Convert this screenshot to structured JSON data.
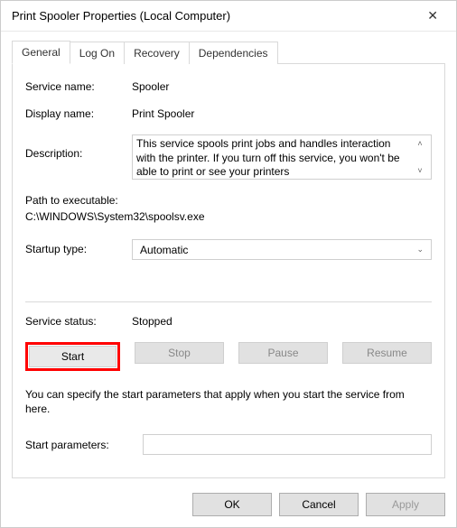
{
  "window": {
    "title": "Print Spooler Properties (Local Computer)"
  },
  "tabs": {
    "general": "General",
    "logon": "Log On",
    "recovery": "Recovery",
    "dependencies": "Dependencies"
  },
  "labels": {
    "service_name": "Service name:",
    "display_name": "Display name:",
    "description": "Description:",
    "path": "Path to executable:",
    "startup_type": "Startup type:",
    "service_status": "Service status:",
    "start_parameters": "Start parameters:"
  },
  "values": {
    "service_name": "Spooler",
    "display_name": "Print Spooler",
    "description": "This service spools print jobs and handles interaction with the printer.  If you turn off this service, you won't be able to print or see your printers",
    "path": "C:\\WINDOWS\\System32\\spoolsv.exe",
    "startup_type": "Automatic",
    "service_status": "Stopped",
    "start_parameters": ""
  },
  "buttons": {
    "start": "Start",
    "stop": "Stop",
    "pause": "Pause",
    "resume": "Resume",
    "ok": "OK",
    "cancel": "Cancel",
    "apply": "Apply"
  },
  "notes": {
    "params": "You can specify the start parameters that apply when you start the service from here."
  }
}
